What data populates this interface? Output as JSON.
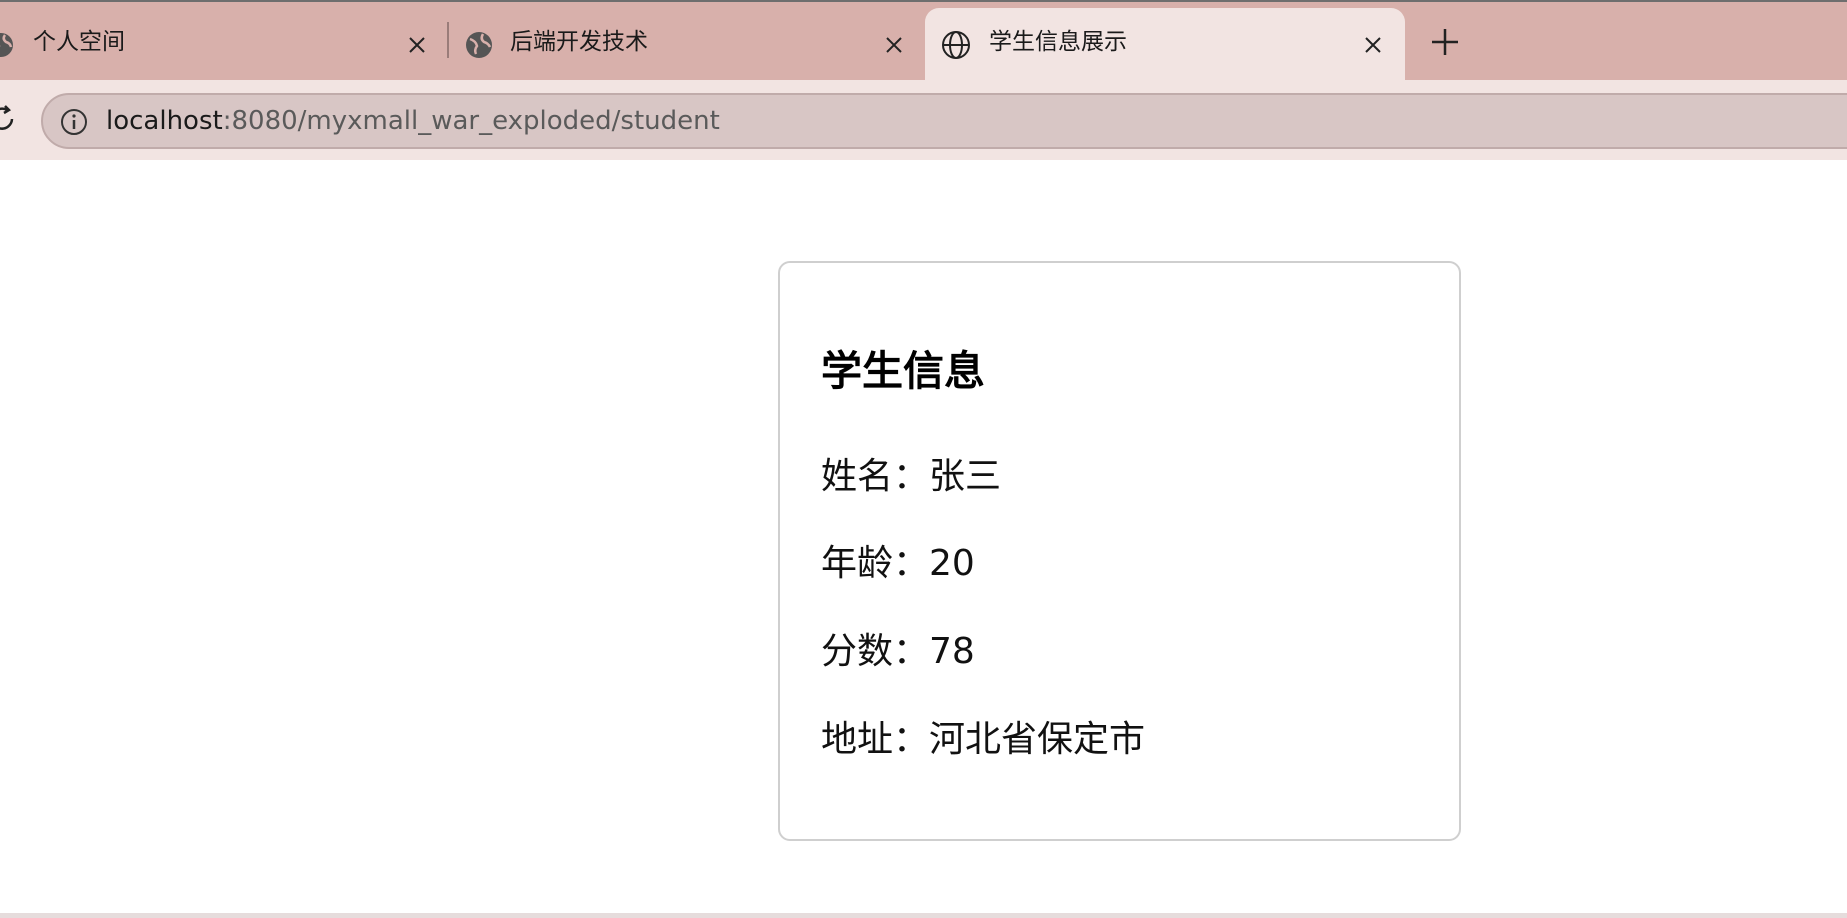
{
  "browser": {
    "tabs": [
      {
        "title": "个人空间",
        "icon": "globe-icon",
        "active": false
      },
      {
        "title": "后端开发技术",
        "icon": "globe-icon",
        "active": false
      },
      {
        "title": "学生信息展示",
        "icon": "globe-icon",
        "active": true
      }
    ],
    "new_tab_symbol": "+",
    "close_symbol": "✕",
    "url_host": "localhost",
    "url_path": ":8080/myxmall_war_exploded/student",
    "colors": {
      "tabstrip_bg": "#d8b0ab",
      "active_tab_bg": "#f2e4e2",
      "omnibox_bg": "#d8c6c5"
    }
  },
  "card": {
    "title": "学生信息",
    "fields": [
      {
        "label": "姓名：",
        "value": "张三"
      },
      {
        "label": "年龄：",
        "value": "20"
      },
      {
        "label": "分数：",
        "value": "78"
      },
      {
        "label": "地址：",
        "value": "河北省保定市"
      }
    ]
  }
}
